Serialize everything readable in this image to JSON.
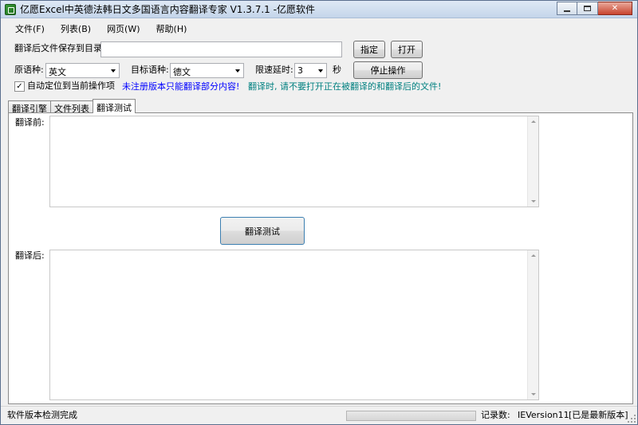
{
  "window": {
    "title": "亿愿Excel中英德法韩日文多国语言内容翻译专家 V1.3.7.1 -亿愿软件"
  },
  "menu": {
    "items": [
      "文件(F)",
      "列表(B)",
      "网页(W)",
      "帮助(H)"
    ]
  },
  "save_dir": {
    "label": "翻译后文件保存到目录:",
    "value": "",
    "specify_label": "指定",
    "open_label": "打开"
  },
  "options": {
    "source_lang_label": "原语种:",
    "source_lang_value": "英文",
    "target_lang_label": "目标语种:",
    "target_lang_value": "德文",
    "delay_label": "限速延时:",
    "delay_value": "3",
    "delay_unit": "秒",
    "stop_label": "停止操作",
    "auto_locate_label": "自动定位到当前操作项",
    "auto_locate_checked": true,
    "unregistered_note": "未注册版本只能翻译部分内容!",
    "warning_note": "翻译时, 请不要打开正在被翻译的和翻译后的文件!"
  },
  "tabs": [
    {
      "label": "翻译引擎",
      "active": false
    },
    {
      "label": "文件列表",
      "active": false
    },
    {
      "label": "翻译测试",
      "active": true
    }
  ],
  "test_panel": {
    "before_label": "翻译前:",
    "before_value": "",
    "translate_button_label": "翻译测试",
    "after_label": "翻译后:",
    "after_value": ""
  },
  "status": {
    "message": "软件版本检测完成",
    "progress": 0,
    "records_label": "记录数:",
    "ie_version": "IEVersion11",
    "version_status": "[已是最新版本]"
  }
}
